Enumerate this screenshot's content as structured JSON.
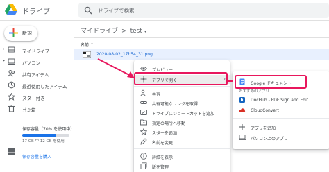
{
  "app": {
    "title": "ドライブ"
  },
  "search": {
    "placeholder": "ドライブで検索"
  },
  "sidebar": {
    "new_label": "新規",
    "items": [
      {
        "label": "マイドライブ",
        "icon": "my-drive-icon"
      },
      {
        "label": "パソコン",
        "icon": "computer-icon"
      },
      {
        "label": "共有アイテム",
        "icon": "shared-icon"
      },
      {
        "label": "最近使用したアイテム",
        "icon": "clock-icon"
      },
      {
        "label": "スター付き",
        "icon": "star-icon"
      },
      {
        "label": "ゴミ箱",
        "icon": "trash-icon"
      }
    ],
    "storage": {
      "label": "保存容量（70% を使用中）",
      "detail": "17 GB 中 12 GB を使用",
      "used_fraction": 0.7,
      "buy_label": "保存容量を購入"
    }
  },
  "main": {
    "breadcrumb": {
      "root": "マイドライブ",
      "separator": ">",
      "current": "test",
      "dropdown": "▾"
    },
    "column_name": "名前",
    "sort_arrow": "↓",
    "file": {
      "name": "2020-08-02_17h54_31.png"
    }
  },
  "context_menu": {
    "items": [
      {
        "label": "プレビュー",
        "icon": "eye-icon"
      },
      {
        "label": "アプリで開く",
        "icon": "move-icon",
        "arrow": "›"
      },
      {
        "label": "共有",
        "icon": "person-add-icon"
      },
      {
        "label": "共有可能なリンクを取得",
        "icon": "link-icon"
      },
      {
        "label": "ドライブにショートカットを追加",
        "icon": "shortcut-icon"
      },
      {
        "label": "指定の場所へ移動",
        "icon": "folder-move-icon"
      },
      {
        "label": "スターを追加",
        "icon": "star-icon"
      },
      {
        "label": "名前を変更",
        "icon": "pencil-icon"
      },
      {
        "label": "詳細を表示",
        "icon": "info-icon"
      },
      {
        "label": "版を管理",
        "icon": "history-icon"
      }
    ]
  },
  "submenu": {
    "google_docs": "Google ドキュメント",
    "heading": "おすすめのアプリ",
    "apps": [
      {
        "label": "DocHub - PDF Sign and Edit",
        "icon": "dochub-icon"
      },
      {
        "label": "CloudConvert",
        "icon": "cloudconvert-icon"
      }
    ],
    "add_app": "アプリを追加",
    "pc_app": "パソコン上のアプリ"
  },
  "colors": {
    "accent": "#1a73e8",
    "annotation": "#e8175d",
    "selection": "#e8f0fe"
  }
}
